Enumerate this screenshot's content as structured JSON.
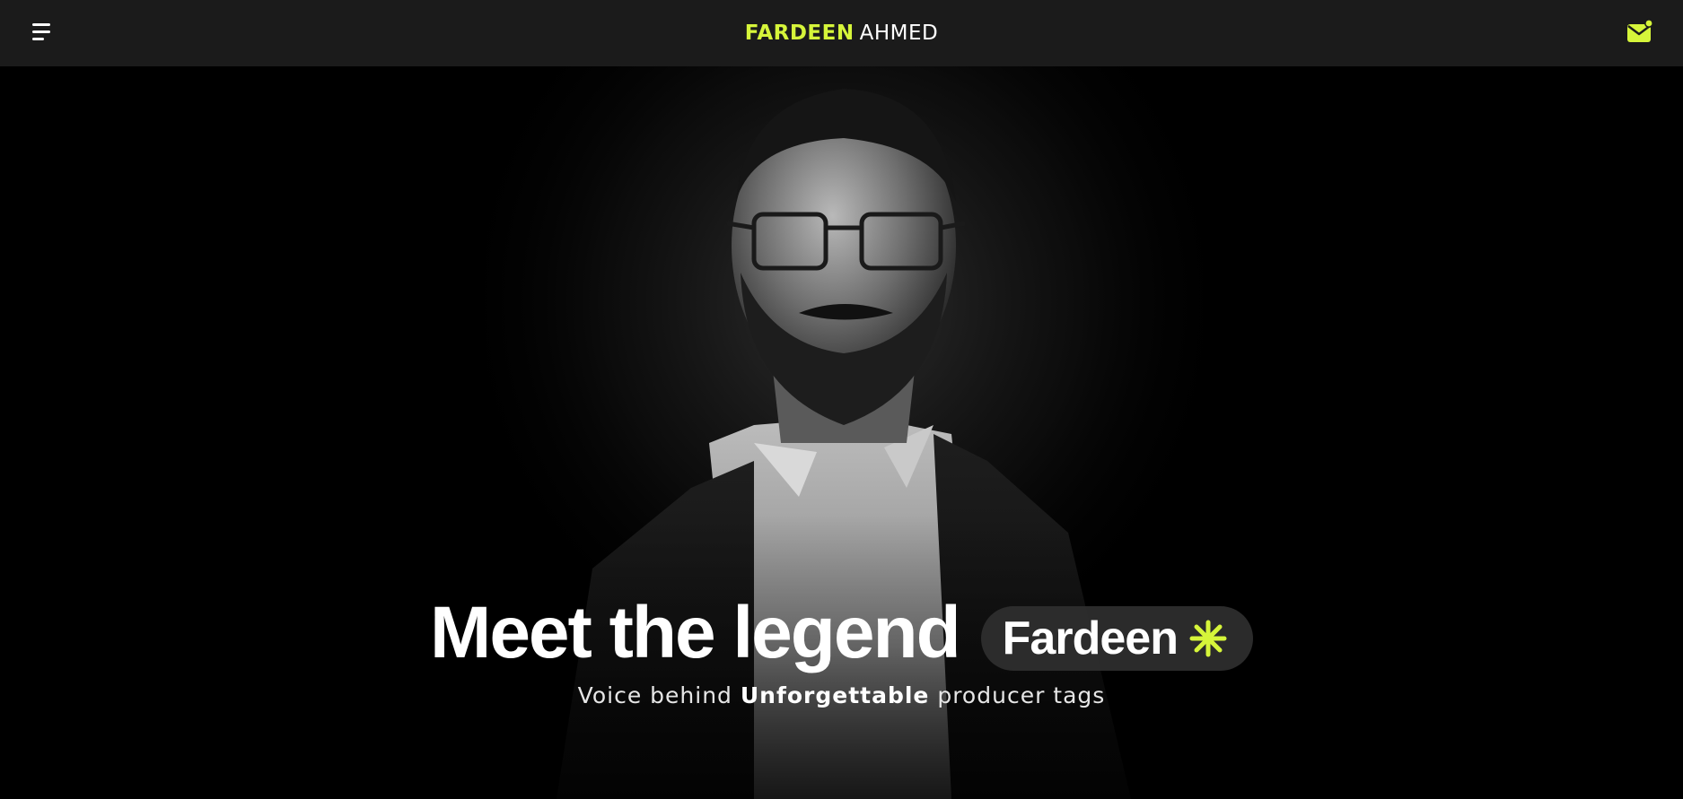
{
  "header": {
    "brand_first": "FARDEEN",
    "brand_last": "AHMED",
    "menu_icon": "hamburger-menu-icon",
    "mail_icon": "mail-notification-icon"
  },
  "hero": {
    "headline": "Meet the legend",
    "name_tag": "Fardeen",
    "sparkle_icon": "sparkle-icon",
    "subline_before": "Voice behind ",
    "subline_bold": "Unforgettable",
    "subline_after": " producer tags"
  },
  "colors": {
    "accent": "#d6f53a",
    "navbar": "#1b1b1b",
    "background": "#000000",
    "pill": "#303030"
  }
}
